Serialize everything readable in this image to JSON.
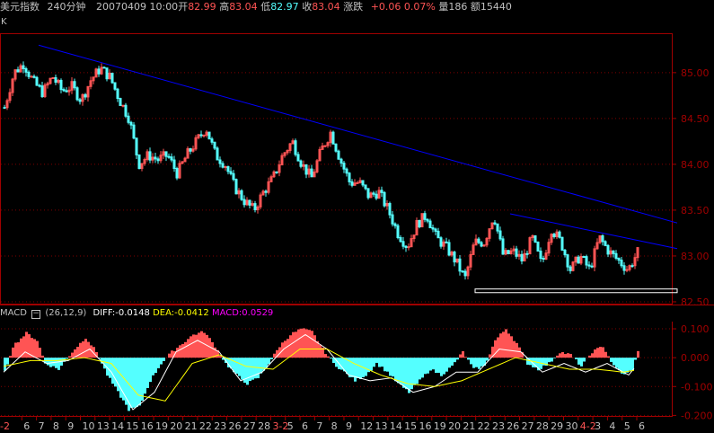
{
  "header": {
    "title": "美元指数",
    "period": "240分钟",
    "datetime": "20070409 10:00",
    "open_label": "开",
    "open": "82.99",
    "high_label": "高",
    "high": "83.04",
    "low_label": "低",
    "low": "82.97",
    "close_label": "收",
    "close": "83.04",
    "change_label": "涨跌",
    "change": "+0.06",
    "change_pct": "0.07%",
    "volume_label": "量",
    "volume": "186",
    "amount_label": "额",
    "amount": "15440"
  },
  "panel_label": "K",
  "macd_header": {
    "name": "MACD",
    "params": "(26,12,9)",
    "diff_label": "DIFF:",
    "diff": "-0.0148",
    "dea_label": "DEA:",
    "dea": "-0.0412",
    "macd_label": "MACD:",
    "macd": "0.0529"
  },
  "colors": {
    "up": "#ff5454",
    "down": "#54ffff",
    "trendline": "#0000ff",
    "support": "#ffffff",
    "axis": "#a00000",
    "grid": "#800000",
    "diff": "#ffffff",
    "dea": "#ffff00",
    "macd_text": "#ff00ff"
  },
  "chart_data": [
    {
      "type": "candlestick",
      "y_ticks": [
        82.5,
        83.0,
        83.5,
        84.0,
        84.5,
        85.0
      ],
      "y_tick_labels": [
        "82.50",
        "83.00",
        "83.50",
        "84.00",
        "84.50",
        "85.00"
      ],
      "ylim": [
        82.48,
        85.42
      ],
      "candles_per_day": 6,
      "close_path": [
        84.62,
        85.0,
        85.1,
        84.9,
        84.78,
        84.96,
        84.8,
        84.85,
        84.7,
        84.92,
        85.05,
        84.95,
        84.7,
        84.5,
        84.0,
        84.1,
        84.05,
        84.1,
        83.9,
        84.1,
        84.25,
        84.4,
        84.1,
        84.0,
        83.75,
        83.6,
        83.5,
        83.7,
        83.85,
        84.1,
        84.25,
        84.0,
        83.85,
        84.15,
        84.35,
        84.05,
        83.8,
        83.8,
        83.65,
        83.7,
        83.5,
        83.25,
        83.1,
        83.35,
        83.45,
        83.2,
        83.1,
        82.95,
        82.75,
        83.15,
        83.15,
        83.45,
        83.0,
        83.05,
        82.95,
        83.2,
        82.9,
        83.3,
        83.15,
        82.85,
        83.0,
        82.85,
        83.2,
        83.05,
        82.95,
        82.85,
        83.04
      ],
      "trendlines": [
        {
          "from": [
            13,
            85.3
          ],
          "to": [
            250,
            83.36
          ]
        },
        {
          "from": [
            188,
            83.46
          ],
          "to": [
            250,
            83.08
          ]
        }
      ],
      "support_box": {
        "x_from": 175,
        "x_to": 250,
        "y_from": 82.6,
        "y_to": 82.64
      }
    },
    {
      "type": "macd",
      "params": "(26,12,9)",
      "y_ticks": [
        0.1,
        0.0,
        -0.1,
        -0.2
      ],
      "y_tick_labels": [
        "0.100",
        "0.000",
        "-0.100",
        "-0.200"
      ],
      "ylim": [
        -0.205,
        0.125
      ],
      "histogram_keypoints": [
        [
          0,
          -0.05
        ],
        [
          3,
          0.04
        ],
        [
          8,
          0.085
        ],
        [
          12,
          0.06
        ],
        [
          15,
          -0.02
        ],
        [
          20,
          -0.04
        ],
        [
          25,
          0.02
        ],
        [
          30,
          0.07
        ],
        [
          34,
          0.02
        ],
        [
          38,
          -0.06
        ],
        [
          42,
          -0.12
        ],
        [
          46,
          -0.18
        ],
        [
          50,
          -0.17
        ],
        [
          54,
          -0.08
        ],
        [
          58,
          -0.02
        ],
        [
          62,
          0.02
        ],
        [
          66,
          0.05
        ],
        [
          70,
          0.08
        ],
        [
          74,
          0.09
        ],
        [
          78,
          0.04
        ],
        [
          82,
          -0.02
        ],
        [
          86,
          -0.06
        ],
        [
          90,
          -0.09
        ],
        [
          94,
          -0.07
        ],
        [
          98,
          -0.02
        ],
        [
          102,
          0.04
        ],
        [
          106,
          0.08
        ],
        [
          110,
          0.1
        ],
        [
          114,
          0.09
        ],
        [
          118,
          0.03
        ],
        [
          122,
          -0.02
        ],
        [
          126,
          -0.05
        ],
        [
          130,
          -0.08
        ],
        [
          134,
          -0.06
        ],
        [
          138,
          -0.02
        ],
        [
          142,
          -0.05
        ],
        [
          146,
          -0.09
        ],
        [
          150,
          -0.12
        ],
        [
          154,
          -0.08
        ],
        [
          158,
          -0.04
        ],
        [
          162,
          -0.06
        ],
        [
          166,
          -0.03
        ],
        [
          170,
          0.02
        ],
        [
          174,
          -0.04
        ],
        [
          178,
          -0.03
        ],
        [
          182,
          0.06
        ],
        [
          186,
          0.1
        ],
        [
          190,
          0.05
        ],
        [
          194,
          -0.02
        ],
        [
          198,
          -0.04
        ],
        [
          202,
          -0.02
        ],
        [
          206,
          0.02
        ],
        [
          210,
          0.01
        ],
        [
          214,
          -0.03
        ],
        [
          218,
          0.02
        ],
        [
          222,
          0.04
        ],
        [
          226,
          -0.03
        ],
        [
          230,
          -0.06
        ],
        [
          233,
          -0.04
        ],
        [
          236,
          0.05
        ]
      ],
      "diff_keypoints": [
        [
          0,
          -0.05
        ],
        [
          8,
          0.02
        ],
        [
          16,
          -0.02
        ],
        [
          24,
          -0.01
        ],
        [
          32,
          0.03
        ],
        [
          40,
          -0.05
        ],
        [
          48,
          -0.18
        ],
        [
          56,
          -0.12
        ],
        [
          64,
          0.02
        ],
        [
          72,
          0.06
        ],
        [
          80,
          0.02
        ],
        [
          88,
          -0.08
        ],
        [
          96,
          -0.05
        ],
        [
          104,
          0.03
        ],
        [
          112,
          0.08
        ],
        [
          120,
          0.03
        ],
        [
          128,
          -0.06
        ],
        [
          136,
          -0.08
        ],
        [
          144,
          -0.07
        ],
        [
          152,
          -0.12
        ],
        [
          160,
          -0.1
        ],
        [
          168,
          -0.05
        ],
        [
          176,
          -0.05
        ],
        [
          184,
          0.03
        ],
        [
          192,
          0.02
        ],
        [
          200,
          -0.05
        ],
        [
          208,
          -0.02
        ],
        [
          216,
          -0.05
        ],
        [
          224,
          -0.02
        ],
        [
          232,
          -0.06
        ],
        [
          236,
          -0.015
        ]
      ],
      "dea_keypoints": [
        [
          0,
          -0.03
        ],
        [
          10,
          -0.01
        ],
        [
          20,
          -0.01
        ],
        [
          30,
          0.0
        ],
        [
          40,
          -0.02
        ],
        [
          50,
          -0.13
        ],
        [
          60,
          -0.15
        ],
        [
          70,
          -0.02
        ],
        [
          80,
          0.01
        ],
        [
          90,
          -0.03
        ],
        [
          100,
          -0.04
        ],
        [
          110,
          0.03
        ],
        [
          120,
          0.03
        ],
        [
          130,
          -0.02
        ],
        [
          140,
          -0.06
        ],
        [
          150,
          -0.09
        ],
        [
          160,
          -0.1
        ],
        [
          170,
          -0.08
        ],
        [
          180,
          -0.04
        ],
        [
          190,
          0.0
        ],
        [
          200,
          -0.02
        ],
        [
          210,
          -0.04
        ],
        [
          220,
          -0.04
        ],
        [
          230,
          -0.05
        ],
        [
          236,
          -0.041
        ]
      ]
    }
  ],
  "x_axis": {
    "day_labels": [
      "2",
      "6",
      "7",
      "8",
      "9",
      "10",
      "13",
      "14",
      "15",
      "16",
      "19",
      "20",
      "21",
      "22",
      "23",
      "26",
      "27",
      "28",
      "3-2",
      "5",
      "6",
      "7",
      "8",
      "9",
      "12",
      "13",
      "14",
      "15",
      "16",
      "19",
      "20",
      "21",
      "22",
      "23",
      "26",
      "27",
      "28",
      "29",
      "30",
      "4-2",
      "3",
      "4",
      "5",
      "6"
    ],
    "month_start_labels": [
      "3-2",
      "4-2"
    ],
    "highlight_first": "-2"
  }
}
